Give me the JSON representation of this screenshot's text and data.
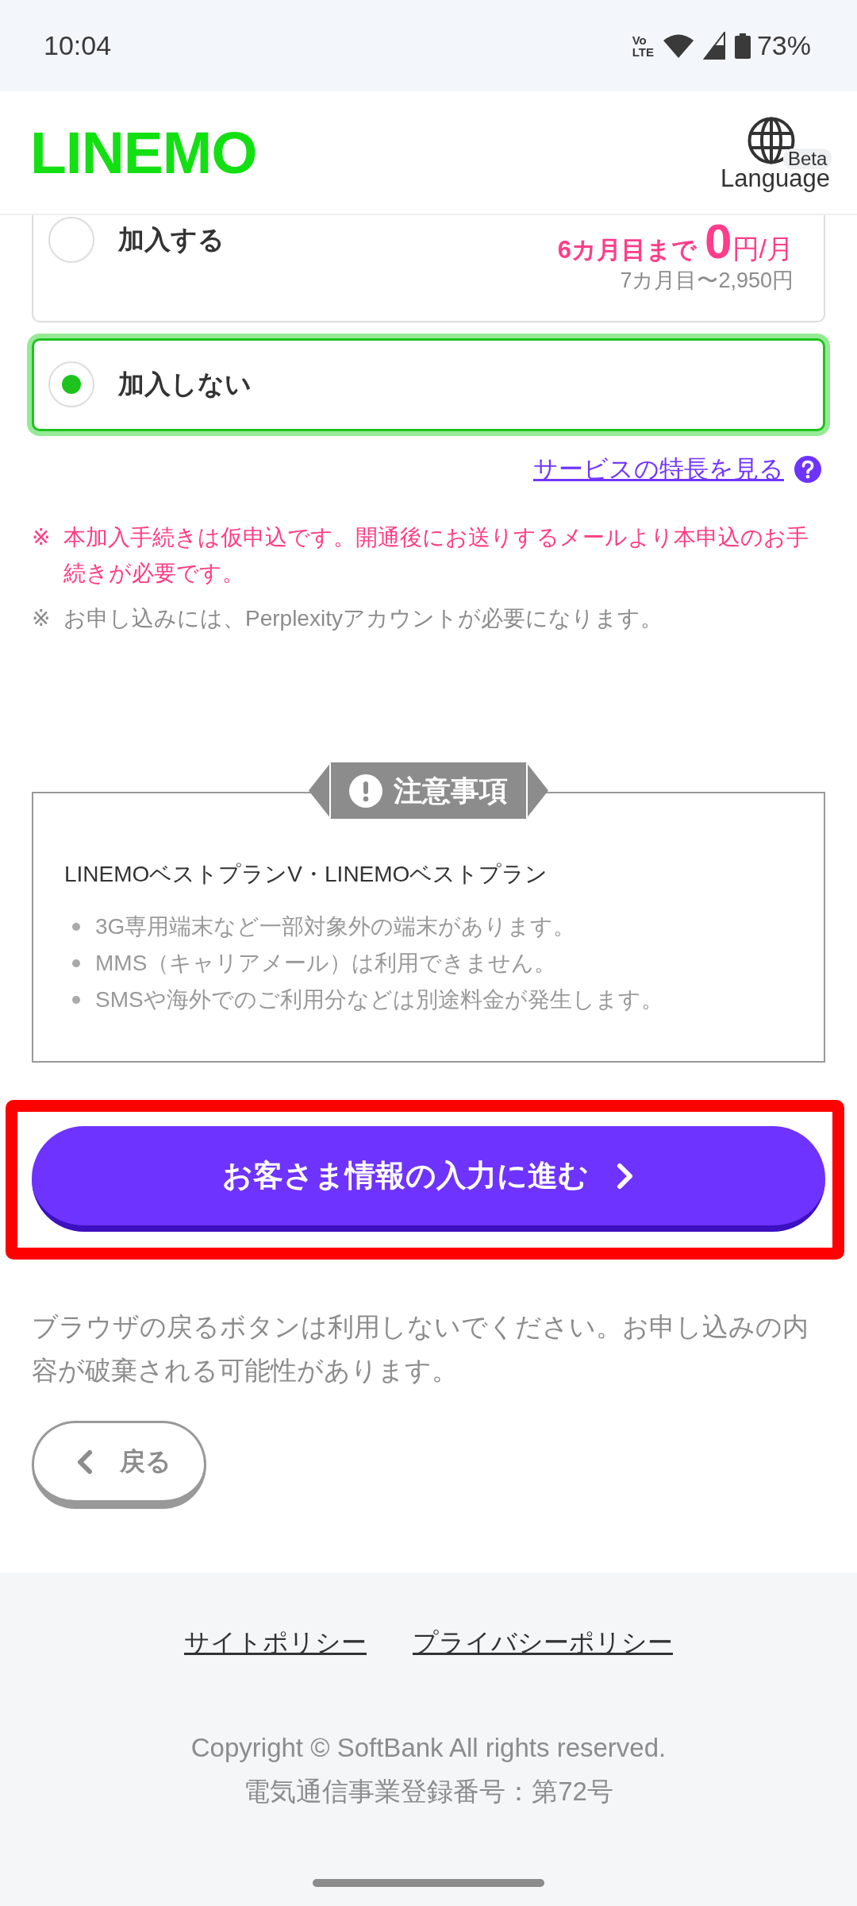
{
  "status_bar": {
    "time": "10:04",
    "network": {
      "top": "Vo",
      "bottom": "LTE"
    },
    "battery": "73%"
  },
  "header": {
    "logo": "LINEMO",
    "language": {
      "label": "Language",
      "badge": "Beta"
    }
  },
  "options": [
    {
      "label": "加入する",
      "selected": false,
      "price": {
        "prefix": "6カ月目まで",
        "amount": "0",
        "unit": "円/月",
        "note": "7カ月目〜2,950円"
      }
    },
    {
      "label": "加入しない",
      "selected": true
    }
  ],
  "feature_link": "サービスの特長を見る",
  "notes": [
    {
      "kind": "alert",
      "mark": "※",
      "text": "本加入手続きは仮申込です。開通後にお送りするメールより本申込のお手続きが必要です。"
    },
    {
      "kind": "info",
      "mark": "※",
      "text": "お申し込みには、Perplexityアカウントが必要になります。"
    }
  ],
  "notice": {
    "title": "注意事項",
    "heading": "LINEMOベストプランV・LINEMOベストプラン",
    "items": [
      "3G専用端末など一部対象外の端末があります。",
      "MMS（キャリアメール）は利用できません。",
      "SMSや海外でのご利用分などは別途料金が発生します。"
    ]
  },
  "primary_button": {
    "label": "お客さま情報の入力に進む",
    "highlighted": true
  },
  "warning": "ブラウザの戻るボタンは利用しないでください。お申し込みの内容が破棄される可能性があります。",
  "back_button": "戻る",
  "footer": {
    "links": [
      "サイトポリシー",
      "プライバシーポリシー"
    ],
    "copyright": "Copyright © SoftBank All rights reserved.",
    "registration": "電気通信事業登録番号：第72号"
  }
}
